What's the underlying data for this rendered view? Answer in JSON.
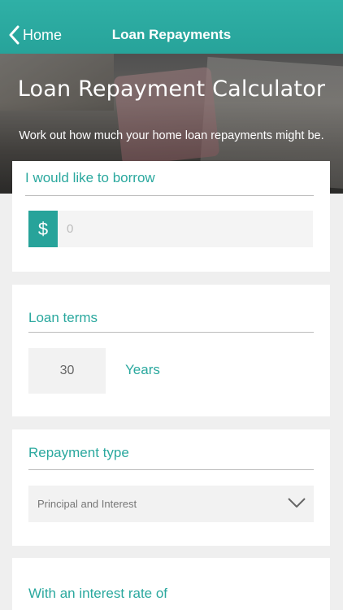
{
  "nav": {
    "back_label": "Home",
    "title": "Loan Repayments"
  },
  "hero": {
    "title": "Loan Repayment Calculator",
    "subtitle": "Work out how much your home loan repayments might be."
  },
  "borrow": {
    "heading": "I would like to borrow",
    "currency_symbol": "$",
    "amount_placeholder": "0"
  },
  "loan_terms": {
    "heading": "Loan terms",
    "years_value": "30",
    "years_label": "Years"
  },
  "repayment_type": {
    "heading": "Repayment type",
    "selected": "Principal and Interest"
  },
  "interest": {
    "heading": "With an interest rate of"
  },
  "colors": {
    "accent": "#27a39a",
    "nav_bar": "#2fb0a6",
    "background": "#efefef"
  }
}
